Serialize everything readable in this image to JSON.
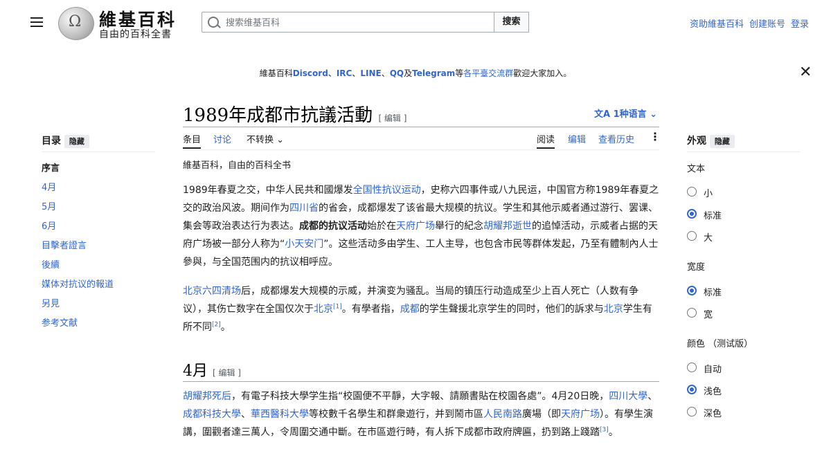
{
  "header": {
    "wordmark": "維基百科",
    "tagline": "自由的百科全書",
    "search_placeholder": "搜索维基百科",
    "search_button": "搜索",
    "user_links": [
      "资助維基百科",
      "创建账号",
      "登录"
    ]
  },
  "banner": {
    "prefix": "維基百科",
    "discord": "Discord",
    "sep1": "、",
    "irc": "IRC",
    "sep2": "、",
    "line": "LINE",
    "sep3": "、",
    "qq": "QQ",
    "and": "及",
    "telegram": "Telegram",
    "mid": "等",
    "groups": "各平臺交流群",
    "suffix": "歡迎大家加入。"
  },
  "article": {
    "title": "1989年成都市抗議活動",
    "title_edit": "[ 编辑 ]",
    "languages": "1种语言",
    "tabs_left": [
      "条目",
      "讨论",
      "不转换"
    ],
    "tabs_right": [
      "阅读",
      "编辑",
      "查看历史"
    ],
    "subtitle": "維基百科，自由的百科全书",
    "section_heading": "4月",
    "section_edit": "[ 编辑 ]"
  },
  "toc": {
    "title": "目录",
    "hide": "隐藏",
    "items": [
      "序言",
      "4月",
      "5月",
      "6月",
      "目擊者證言",
      "後續",
      "媒体对抗议的報道",
      "另見",
      "参考文献"
    ]
  },
  "appearance": {
    "title": "外观",
    "hide": "隐藏",
    "text_label": "文本",
    "text_options": [
      "小",
      "标准",
      "大"
    ],
    "width_label": "宽度",
    "width_options": [
      "标准",
      "宽"
    ],
    "color_label": "颜色 （测试版）",
    "color_options": [
      "自动",
      "浅色",
      "深色"
    ],
    "selected": {
      "text": 1,
      "width": 0,
      "color": 1
    }
  },
  "paragraphs": {
    "p1": [
      "1989年春夏之交，中华人民共和國爆发",
      "全国性抗议运动",
      "，史称六四事件或八九民运，中国官方称1989年春夏之交的政治风波。期间作为",
      "四川省",
      "的省会，成都爆发了该省最大规模的抗议。学生和其他示威者通过游行、罢课、集会等政治表达行为表达。",
      "成都的抗议活动",
      "始於在",
      "天府广场",
      "舉行的紀念",
      "胡耀邦逝世",
      "的追悼活动，示威者占据的天府广场被一部分人称为“",
      "小天安门",
      "”。这些活动多由学生、工人主导，也包含市民等群体发起，乃至有體制內人士參與，与全国范围内的抗议相呼应。"
    ],
    "p2": [
      "北京六四清场",
      "后，成都爆发大规模的示威，并演变为骚乱。当局的镇压行动造成至少上百人死亡（人数有争议），其伤亡数字在全国仅次于",
      "北京",
      "[1]",
      "。有學者指，",
      "成都",
      "的学生聲援北京学生的同时，他们的訴求与",
      "北京",
      "学生有所不同",
      "[2]",
      "。"
    ],
    "p3": [
      "胡耀邦死后",
      "，有電子科技大學学生指“校園便不平靜，大字報、請願書貼在校園各處”。4月20日晚，",
      "四川大學",
      "、",
      "成都科技大學",
      "、",
      "華西醫科大學",
      "等校數千名學生和群衆遊行，并到鬧市區",
      "人民南路",
      "廣場（即",
      "天府广场",
      "）。有學生演講，圍觀者達三萬人，令周圍交通中斷。在市區遊行時，有人拆下成都市政府牌匾，扔到路上踐踏",
      "[3]",
      "。"
    ]
  }
}
